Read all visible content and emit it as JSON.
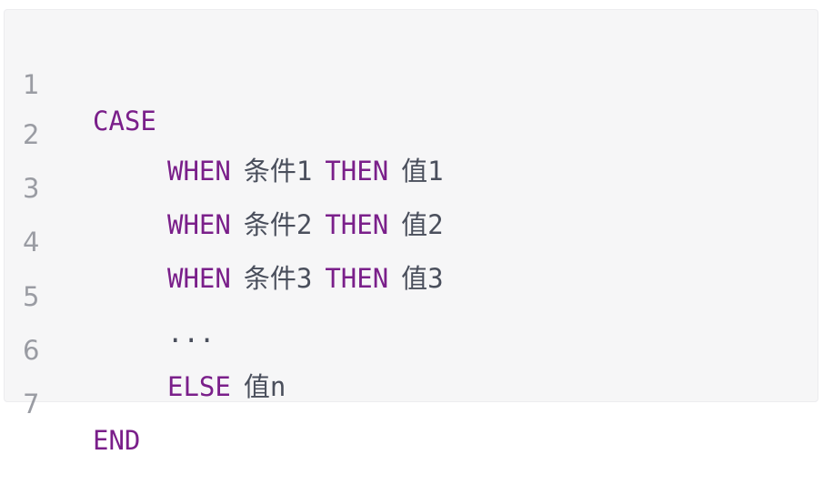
{
  "code_lines": [
    {
      "number": "1",
      "tokens": [
        {
          "type": "keyword",
          "text": "CASE"
        }
      ]
    },
    {
      "number": "2",
      "tokens": [
        {
          "type": "keyword",
          "text": "WHEN"
        },
        {
          "type": "plain",
          "text": "条件1"
        },
        {
          "type": "keyword",
          "text": "THEN"
        },
        {
          "type": "plain",
          "text": "值1"
        }
      ]
    },
    {
      "number": "3",
      "tokens": [
        {
          "type": "keyword",
          "text": "WHEN"
        },
        {
          "type": "plain",
          "text": "条件2"
        },
        {
          "type": "keyword",
          "text": "THEN"
        },
        {
          "type": "plain",
          "text": "值2"
        }
      ]
    },
    {
      "number": "4",
      "tokens": [
        {
          "type": "keyword",
          "text": "WHEN"
        },
        {
          "type": "plain",
          "text": "条件3"
        },
        {
          "type": "keyword",
          "text": "THEN"
        },
        {
          "type": "plain",
          "text": "值3"
        }
      ]
    },
    {
      "number": "5",
      "tokens": [
        {
          "type": "plain",
          "text": "..."
        }
      ]
    },
    {
      "number": "6",
      "tokens": [
        {
          "type": "keyword",
          "text": "ELSE"
        },
        {
          "type": "plain",
          "text": "值n"
        }
      ]
    },
    {
      "number": "7",
      "tokens": [
        {
          "type": "keyword",
          "text": "END"
        }
      ]
    }
  ],
  "colors": {
    "background": "#f6f6f7",
    "keyword": "#7a1f8a",
    "text": "#4a4f5c",
    "line_number": "#9a9ca3"
  }
}
